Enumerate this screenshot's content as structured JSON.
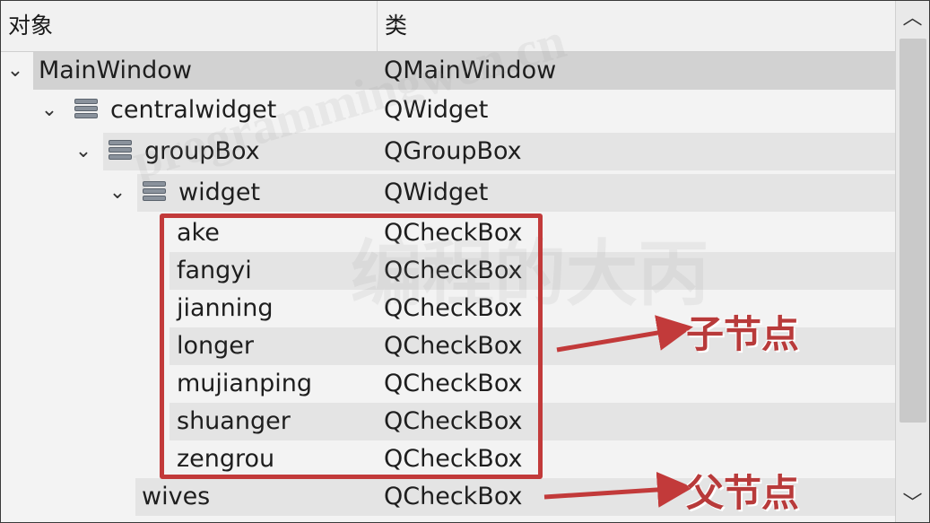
{
  "header": {
    "col_object": "对象",
    "col_class": "类"
  },
  "tree": {
    "rows": [
      {
        "name": "MainWindow",
        "cls": "QMainWindow",
        "depth": 0,
        "expanded": true,
        "has_icon": false,
        "shade": "sel"
      },
      {
        "name": "centralwidget",
        "cls": "QWidget",
        "depth": 1,
        "expanded": true,
        "has_icon": true,
        "shade": "none"
      },
      {
        "name": "groupBox",
        "cls": "QGroupBox",
        "depth": 2,
        "expanded": true,
        "has_icon": true,
        "shade": "alt"
      },
      {
        "name": "widget",
        "cls": "QWidget",
        "depth": 3,
        "expanded": true,
        "has_icon": true,
        "shade": "alt"
      },
      {
        "name": "ake",
        "cls": "QCheckBox",
        "depth": 4,
        "expanded": null,
        "has_icon": false,
        "shade": "none"
      },
      {
        "name": "fangyi",
        "cls": "QCheckBox",
        "depth": 4,
        "expanded": null,
        "has_icon": false,
        "shade": "alt"
      },
      {
        "name": "jianning",
        "cls": "QCheckBox",
        "depth": 4,
        "expanded": null,
        "has_icon": false,
        "shade": "none"
      },
      {
        "name": "longer",
        "cls": "QCheckBox",
        "depth": 4,
        "expanded": null,
        "has_icon": false,
        "shade": "alt"
      },
      {
        "name": "mujianping",
        "cls": "QCheckBox",
        "depth": 4,
        "expanded": null,
        "has_icon": false,
        "shade": "none"
      },
      {
        "name": "shuanger",
        "cls": "QCheckBox",
        "depth": 4,
        "expanded": null,
        "has_icon": false,
        "shade": "alt"
      },
      {
        "name": "zengrou",
        "cls": "QCheckBox",
        "depth": 4,
        "expanded": null,
        "has_icon": false,
        "shade": "none"
      },
      {
        "name": "wives",
        "cls": "QCheckBox",
        "depth": 3,
        "expanded": null,
        "has_icon": false,
        "shade": "alt"
      }
    ]
  },
  "annotations": {
    "child_label": "子节点",
    "parent_label": "父节点",
    "color": "#c23a3a"
  },
  "scrollbar": {
    "up_icon": "chevron-up-icon",
    "down_icon": "chevron-down-icon"
  },
  "watermark": {
    "latin": "programmingwen.cn",
    "cjk": "编程的大丙"
  },
  "colors": {
    "background": "#f3f3f3",
    "row_alt": "#e4e4e4",
    "row_selected": "#d2d2d2",
    "annotation_red": "#c23a3a"
  }
}
